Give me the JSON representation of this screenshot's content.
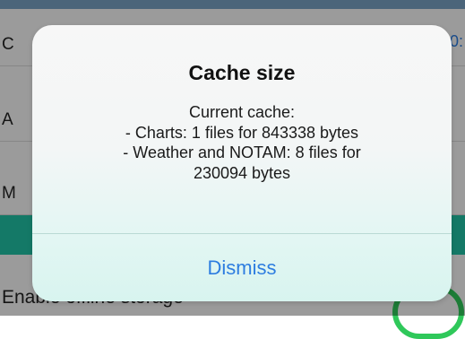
{
  "background": {
    "rows": [
      {
        "label": "C"
      },
      {
        "label": "A"
      },
      {
        "label": "M"
      }
    ],
    "last_row_label": "Enable offline storage",
    "edge_value": "0:"
  },
  "alert": {
    "title": "Cache size",
    "message_lines": [
      "Current cache:",
      "- Charts: 1 files for 843338 bytes",
      "- Weather and NOTAM: 8 files for",
      "230094 bytes"
    ],
    "button_label": "Dismiss"
  },
  "colors": {
    "accent_blue": "#2d7de0",
    "teal_row": "#21c3a6",
    "toggle_green": "#2fc85a"
  }
}
